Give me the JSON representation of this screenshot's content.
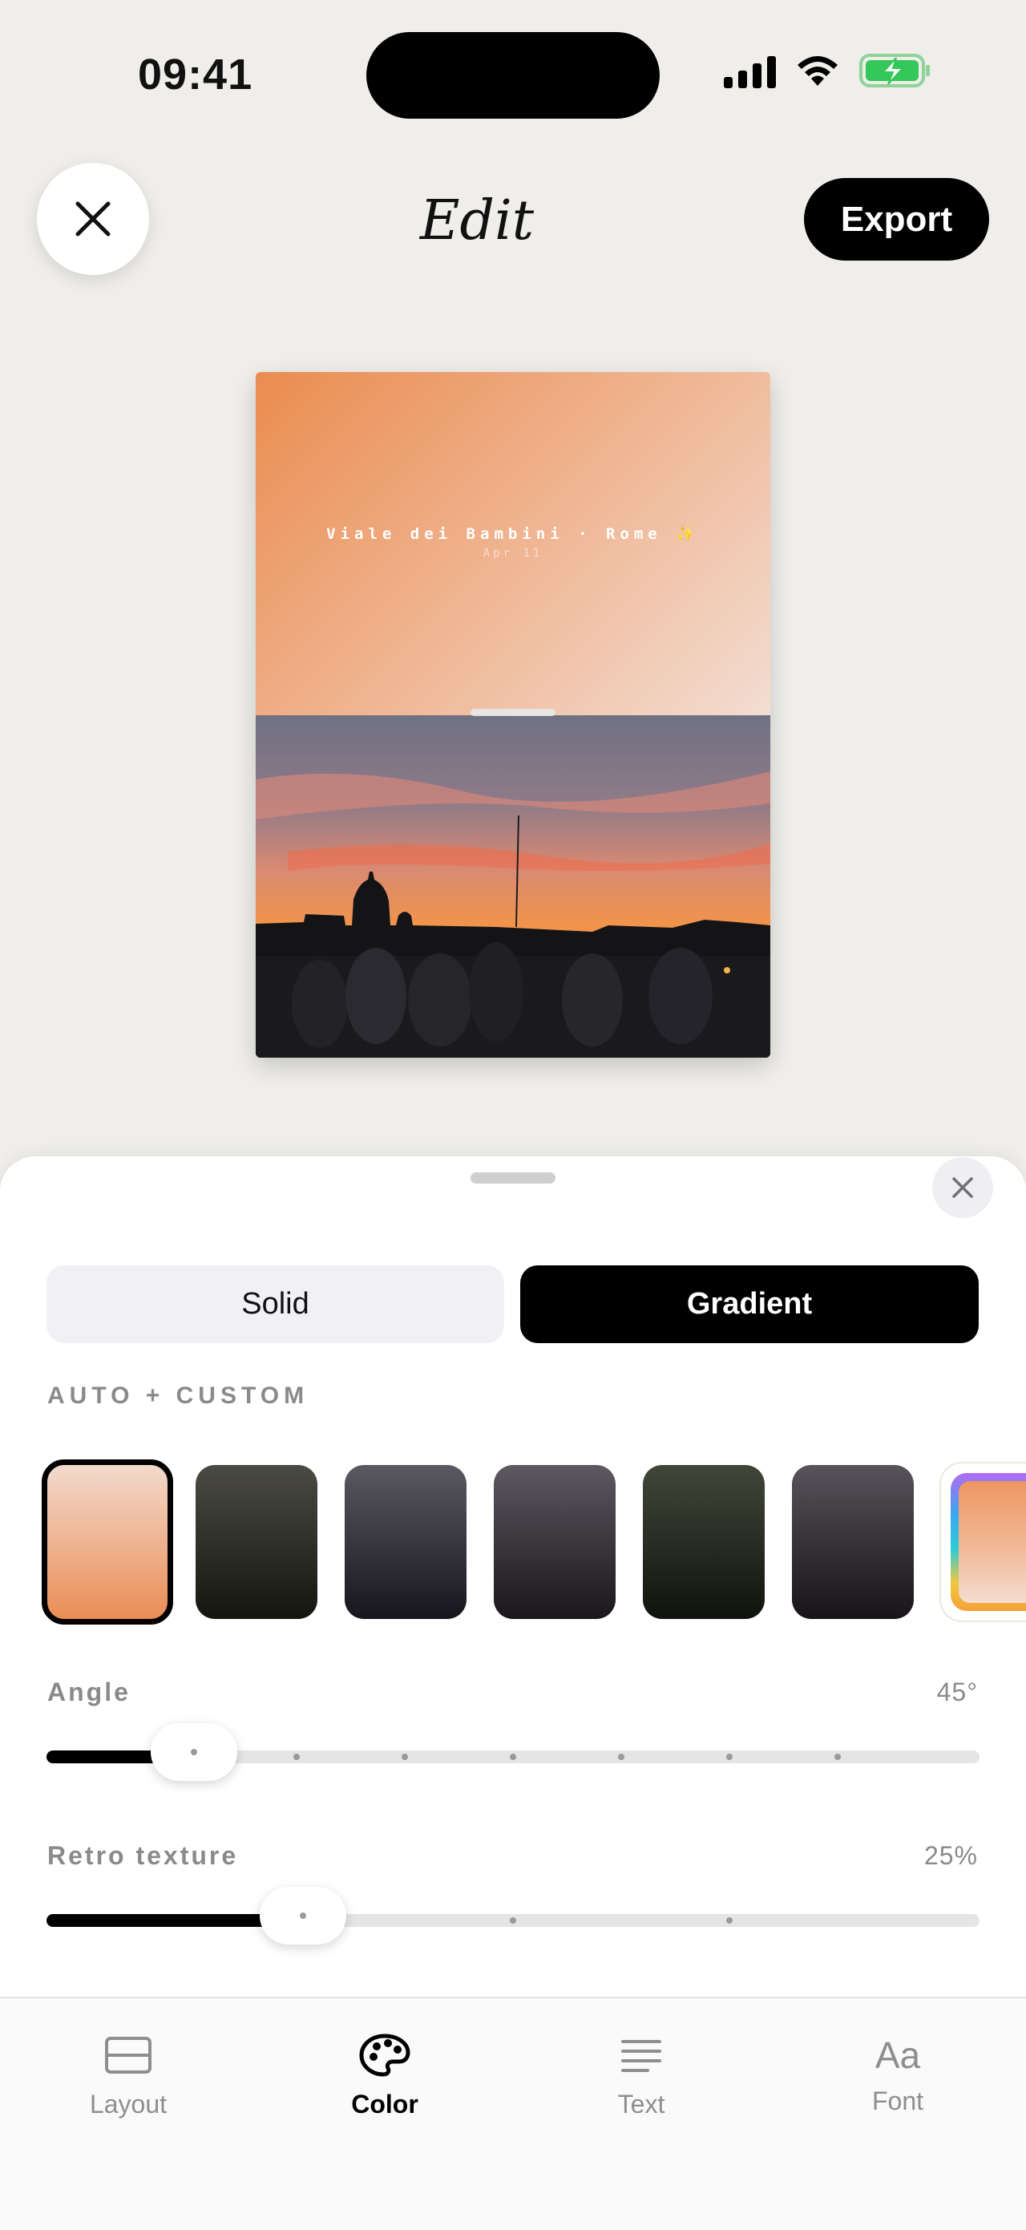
{
  "status_bar": {
    "time": "09:41"
  },
  "header": {
    "title": "Edit",
    "export_label": "Export"
  },
  "card": {
    "caption": "Viale dei Bambini · Rome ✨",
    "date": "Apr 11"
  },
  "panel": {
    "tabs": [
      {
        "label": "Solid",
        "selected": false
      },
      {
        "label": "Gradient",
        "selected": true
      }
    ],
    "section_label": "AUTO + CUSTOM",
    "swatches": [
      {
        "name": "peach",
        "top": "#f3dacd",
        "bottom": "#ea8d55",
        "selected": true
      },
      {
        "name": "olive-dark",
        "top": "#4b4a44",
        "bottom": "#15150f"
      },
      {
        "name": "slate",
        "top": "#5a5962",
        "bottom": "#17161c"
      },
      {
        "name": "plum-gray",
        "top": "#5e5861",
        "bottom": "#1a161a"
      },
      {
        "name": "forest",
        "top": "#414639",
        "bottom": "#10130d"
      },
      {
        "name": "mauve-gray",
        "top": "#58525a",
        "bottom": "#181418"
      }
    ],
    "custom_swatch_icon": "custom-gradient-icon",
    "angle": {
      "label": "Angle",
      "value_text": "45°",
      "fraction": 0.158
    },
    "texture": {
      "label": "Retro texture",
      "value_text": "25%",
      "fraction": 0.275
    }
  },
  "tabbar": {
    "items": [
      {
        "label": "Layout",
        "icon": "layout-icon",
        "active": false
      },
      {
        "label": "Color",
        "icon": "palette-icon",
        "active": true
      },
      {
        "label": "Text",
        "icon": "text-lines-icon",
        "active": false
      },
      {
        "label": "Font",
        "icon": "Aa",
        "active": false
      }
    ]
  },
  "colors": {
    "accent": "#000000",
    "background": "#efeeea",
    "sheet": "#ffffff"
  }
}
